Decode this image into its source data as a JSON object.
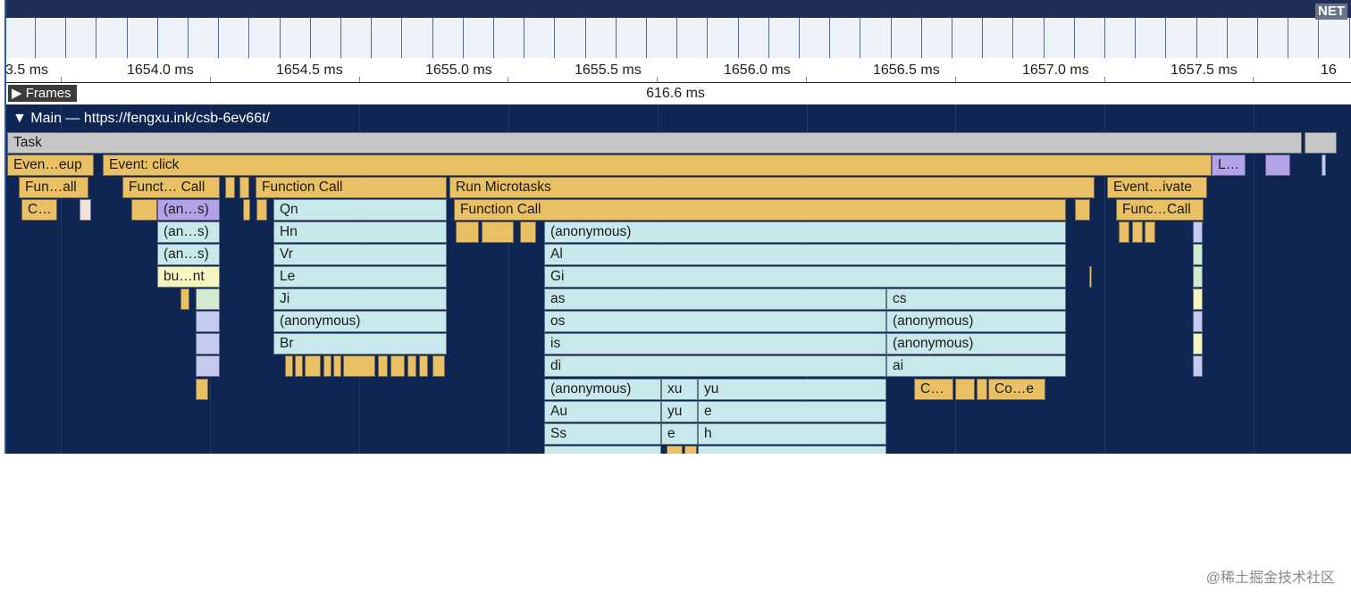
{
  "overview": {
    "net_label": "NET"
  },
  "ruler": {
    "ticks": [
      "3.5 ms",
      "1654.0 ms",
      "1654.5 ms",
      "1655.0 ms",
      "1655.5 ms",
      "1656.0 ms",
      "1656.5 ms",
      "1657.0 ms",
      "1657.5 ms",
      "16"
    ]
  },
  "frames": {
    "label": "Frames",
    "duration": "616.6 ms"
  },
  "main": {
    "title": "Main — https://fengxu.ink/csb-6ev66t/"
  },
  "tracks": {
    "task": "Task",
    "event_pointerup": "Even…eup",
    "event_click": "Event: click",
    "event_l": "L…",
    "fun_all": "Fun…all",
    "c_short": "C…",
    "funct_call": "Funct… Call",
    "an1": "(an…s)",
    "an2": "(an…s)",
    "an3": "(an…s)",
    "bunt": "bu…nt",
    "function_call_1": "Function Call",
    "qn": "Qn",
    "hn": "Hn",
    "vr": "Vr",
    "le": "Le",
    "ji": "Ji",
    "anon_1": "(anonymous)",
    "br": "Br",
    "run_microtasks": "Run Microtasks",
    "function_call_2": "Function Call",
    "anon_2": "(anonymous)",
    "al": "Al",
    "gi": "Gi",
    "as": "as",
    "cs": "cs",
    "os": "os",
    "anon_3": "(anonymous)",
    "is": "is",
    "anon_4": "(anonymous)",
    "di": "di",
    "ai": "ai",
    "anon_5": "(anonymous)",
    "xu": "xu",
    "yu_1": "yu",
    "au": "Au",
    "yu_2": "yu",
    "e_1": "e",
    "ss": "Ss",
    "e_2": "e",
    "h": "h",
    "c_2": "C…",
    "coe": "Co…e",
    "event_ivate": "Event…ivate",
    "func_call": "Func…Call"
  },
  "watermark": "@稀土掘金技术社区"
}
